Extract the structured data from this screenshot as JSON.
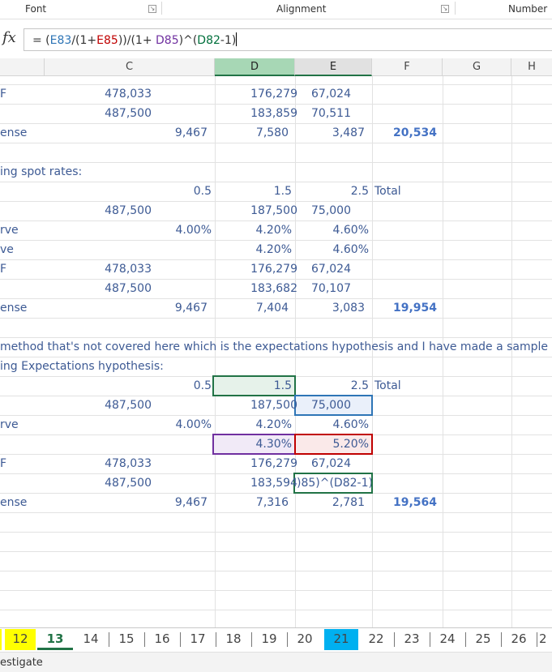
{
  "ribbon": {
    "groups": [
      "Font",
      "Alignment",
      "Number"
    ]
  },
  "formula_bar": {
    "fx_label": "fx",
    "parts": [
      {
        "text": "= (",
        "color": "#333333"
      },
      {
        "text": "E83",
        "color": "#2e75b6"
      },
      {
        "text": "/(1+",
        "color": "#333333"
      },
      {
        "text": "E85",
        "color": "#c00000"
      },
      {
        "text": "))/(1+ ",
        "color": "#333333"
      },
      {
        "text": "D85",
        "color": "#7030a0"
      },
      {
        "text": ")^(",
        "color": "#333333"
      },
      {
        "text": "D82",
        "color": "#00703c"
      },
      {
        "text": "-1)",
        "color": "#333333"
      }
    ]
  },
  "columns": [
    "C",
    "D",
    "E",
    "F",
    "G",
    "H"
  ],
  "rows": {
    "r0": {
      "a": "",
      "d": "...",
      "e": "..."
    },
    "r1": {
      "a": "F",
      "c": "478,033",
      "d": "176,279",
      "e": "67,024"
    },
    "r2": {
      "c": "487,500",
      "d": "183,859",
      "e": "70,511"
    },
    "r3": {
      "a": "ense",
      "c2": "9,467",
      "d": "7,580",
      "e": "3,487",
      "f": "20,534"
    },
    "r5": {
      "a": "ing spot rates:"
    },
    "r6": {
      "c2": "0.5",
      "d": "1.5",
      "e": "2.5",
      "f": "Total"
    },
    "r7": {
      "c": "487,500",
      "d": "187,500",
      "e": "75,000"
    },
    "r8": {
      "a": "rve",
      "c2": "4.00%",
      "d": "4.20%",
      "e": "4.60%"
    },
    "r9": {
      "a": "ve",
      "d": "4.20%",
      "e": "4.60%"
    },
    "r10": {
      "a": "F",
      "c": "478,033",
      "d": "176,279",
      "e": "67,024"
    },
    "r11": {
      "c": "487,500",
      "d": "183,682",
      "e": "70,107"
    },
    "r12": {
      "a": "ense",
      "c2": "9,467",
      "d": "7,404",
      "e": "3,083",
      "f": "19,954"
    },
    "r14": {
      "a": "method that's not covered here which is the expectations hypothesis and I have made a sample"
    },
    "r15": {
      "a": "ing Expectations hypothesis:"
    },
    "r16": {
      "c2": "0.5",
      "d": "1.5",
      "e": "2.5",
      "f": "Total"
    },
    "r17": {
      "c": "487,500",
      "d": "187,500",
      "e": "75,000"
    },
    "r18": {
      "a": "rve",
      "c2": "4.00%",
      "d": "4.20%",
      "e": "4.60%"
    },
    "r19": {
      "d": "4.30%",
      "e": "5.20%"
    },
    "r20": {
      "a": "F",
      "c": "478,033",
      "d": "176,279",
      "e": "67,024"
    },
    "r21": {
      "c": "487,500",
      "d": "183,594",
      "e": ")85)^(D82-1)"
    },
    "r22": {
      "a": "ense",
      "c2": "9,467",
      "d": "7,316",
      "e": "2,781",
      "f": "19,564"
    }
  },
  "sheet_tabs": [
    {
      "label": "12",
      "bg": "#ffff00"
    },
    {
      "label": "13",
      "bg": "#ffffff",
      "active": true
    },
    {
      "label": "14"
    },
    {
      "label": "15"
    },
    {
      "label": "16"
    },
    {
      "label": "17"
    },
    {
      "label": "18"
    },
    {
      "label": "19"
    },
    {
      "label": "20"
    },
    {
      "label": "21",
      "bg": "#00b0f0"
    },
    {
      "label": "22"
    },
    {
      "label": "23"
    },
    {
      "label": "24"
    },
    {
      "label": "25"
    },
    {
      "label": "26"
    },
    {
      "label": "2"
    }
  ],
  "status_bar": {
    "text": "estigate"
  }
}
